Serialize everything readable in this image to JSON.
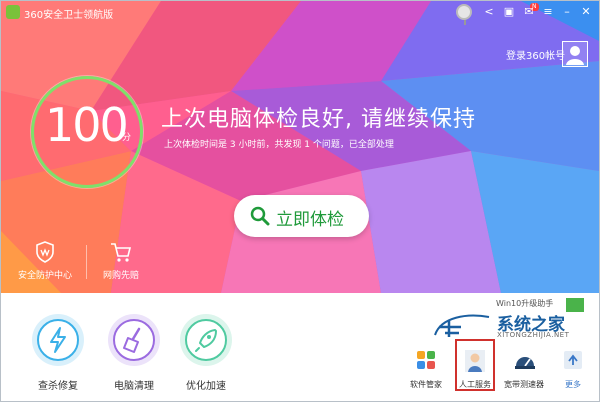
{
  "window": {
    "title": "360安全卫士领航版"
  },
  "header": {
    "login_label": "登录360帐号"
  },
  "checkup": {
    "score": "100",
    "score_unit": "分",
    "headline": "上次电脑体检良好, 请继续保持",
    "subline": "上次体检时间是 3 小时前，共发现 1 个问题，已全部处理",
    "cta_label": "立即体检"
  },
  "hero_links": [
    {
      "label": "安全防护中心",
      "icon": "shield-icon"
    },
    {
      "label": "网购先赔",
      "icon": "cart-icon"
    }
  ],
  "tools": [
    {
      "label": "查杀修复",
      "icon": "lightning-icon",
      "color": "#3ab0e8"
    },
    {
      "label": "电脑清理",
      "icon": "broom-icon",
      "color": "#9b6be0"
    },
    {
      "label": "优化加速",
      "icon": "rocket-icon",
      "color": "#4fcaa0"
    }
  ],
  "quick_apps": [
    {
      "label": "软件管家",
      "icon": "grid-icon"
    },
    {
      "label": "人工服务",
      "icon": "agent-icon"
    },
    {
      "label": "宽带测速器",
      "icon": "speedometer-icon"
    },
    {
      "label": "更多",
      "icon": "more-icon"
    }
  ],
  "watermark": {
    "promo": "Win10升级助手",
    "title": "系统之家",
    "url": "XITONGZHIJIA.NET"
  },
  "colors": {
    "accent_green": "#1f9a3a",
    "ring_green": "#7fe06a",
    "highlight_red": "#d0312d"
  }
}
